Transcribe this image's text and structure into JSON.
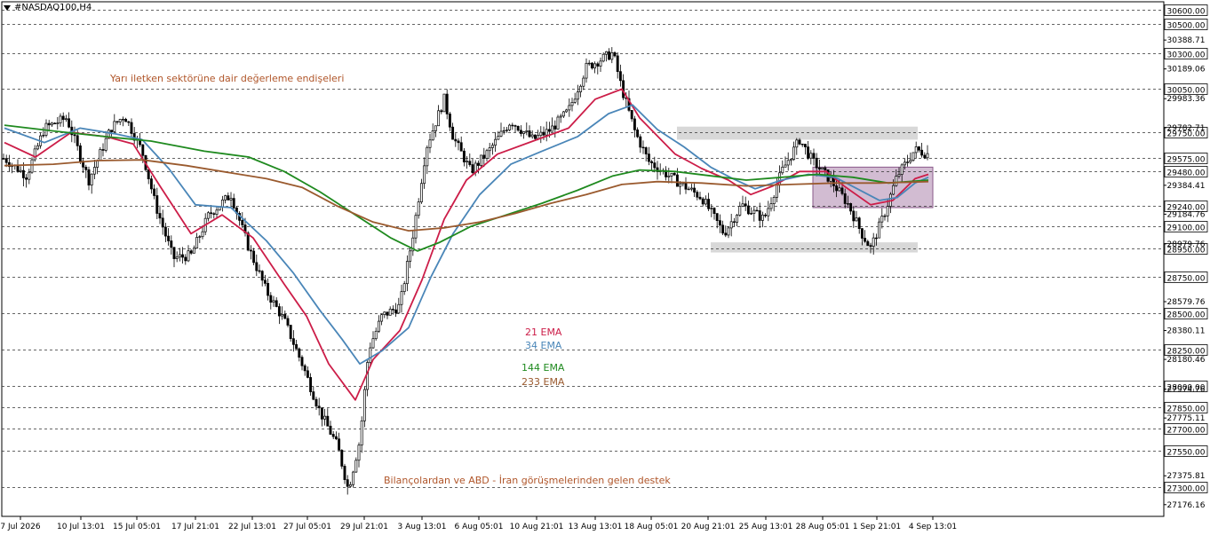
{
  "symbol_title": "#NASDAQ100,H4",
  "annotations": [
    {
      "text": "Yarı iletken sektörüne dair değerleme endişeleri",
      "color": "#b0562a"
    },
    {
      "text": "21 EMA",
      "color": "#cc1d48"
    },
    {
      "text": "34 EMA",
      "color": "#4a86b8"
    },
    {
      "text": "144 EMA",
      "color": "#1f8a1f"
    },
    {
      "text": "233 EMA",
      "color": "#9a5a2e"
    },
    {
      "text": "Bilançolardan ve ABD - İran görüşmelerinden gelen destek",
      "color": "#b0562a"
    }
  ],
  "colors": {
    "ema21": "#cc1d48",
    "ema34": "#4a86b8",
    "ema144": "#1f8a1f",
    "ema233": "#9a5a2e",
    "candles": "#000000",
    "zone_gray": "#c8c8c8",
    "zone_purple": "#9c6b9c"
  },
  "chart_data": {
    "type": "candlestick",
    "y_range": [
      27160,
      30660
    ],
    "x_range": [
      0,
      1310
    ],
    "level_labels": [
      "30600.00",
      "30500.00",
      "30300.00",
      "30050.00",
      "29750.00",
      "29575.00",
      "29480.00",
      "29240.00",
      "29100.00",
      "28950.00",
      "28750.00",
      "28500.00",
      "28250.00",
      "28000.00",
      "27850.00",
      "27700.00",
      "27550.00",
      "27300.00"
    ],
    "level_values": [
      30600,
      30500,
      30300,
      30050,
      29750,
      29575,
      29480,
      29240,
      29100,
      28950,
      28750,
      28500,
      28250,
      28000,
      27850,
      27700,
      27550,
      27300
    ],
    "axis_tick_labels": [
      "30388.71",
      "30189.06",
      "29983.36",
      "29782.71",
      "29384.41",
      "29184.76",
      "28979.76",
      "28579.76",
      "28380.11",
      "28180.46",
      "27974.76",
      "27775.11",
      "27375.81",
      "27176.16"
    ],
    "axis_tick_values": [
      30388.71,
      30189.06,
      29983.36,
      29782.71,
      29384.41,
      29184.76,
      28979.76,
      28579.76,
      28380.11,
      28180.46,
      27974.76,
      27775.11,
      27375.81,
      27176.16
    ],
    "x_tick_labels": [
      "7 Jul 2026",
      "10 Jul 13:01",
      "15 Jul 05:01",
      "17 Jul 21:01",
      "22 Jul 13:01",
      "27 Jul 05:01",
      "29 Jul 21:01",
      "3 Aug 13:01",
      "6 Aug 05:01",
      "10 Aug 21:01",
      "13 Aug 13:01",
      "18 Aug 05:01",
      "20 Aug 21:01",
      "25 Aug 13:01",
      "28 Aug 05:01",
      "1 Sep 21:01",
      "4 Sep 13:01"
    ],
    "x_tick_positions": [
      23,
      91,
      154,
      220,
      284,
      346,
      410,
      475,
      539,
      604,
      670,
      733,
      797,
      862,
      926,
      987,
      1050
    ],
    "price_path": [
      [
        5,
        29570
      ],
      [
        30,
        29450
      ],
      [
        50,
        29780
      ],
      [
        75,
        29850
      ],
      [
        100,
        29420
      ],
      [
        125,
        29780
      ],
      [
        140,
        29870
      ],
      [
        160,
        29620
      ],
      [
        175,
        29250
      ],
      [
        195,
        28880
      ],
      [
        215,
        28900
      ],
      [
        235,
        29180
      ],
      [
        260,
        29320
      ],
      [
        280,
        28950
      ],
      [
        300,
        28650
      ],
      [
        320,
        28450
      ],
      [
        340,
        28150
      ],
      [
        360,
        27820
      ],
      [
        380,
        27580
      ],
      [
        392,
        27280
      ],
      [
        405,
        27620
      ],
      [
        415,
        28250
      ],
      [
        430,
        28480
      ],
      [
        450,
        28550
      ],
      [
        465,
        29050
      ],
      [
        480,
        29650
      ],
      [
        500,
        29980
      ],
      [
        510,
        29720
      ],
      [
        530,
        29480
      ],
      [
        550,
        29620
      ],
      [
        575,
        29830
      ],
      [
        600,
        29700
      ],
      [
        620,
        29770
      ],
      [
        640,
        29900
      ],
      [
        660,
        30200
      ],
      [
        690,
        30300
      ],
      [
        700,
        30050
      ],
      [
        715,
        29750
      ],
      [
        730,
        29550
      ],
      [
        760,
        29420
      ],
      [
        790,
        29300
      ],
      [
        815,
        29050
      ],
      [
        835,
        29250
      ],
      [
        860,
        29150
      ],
      [
        880,
        29480
      ],
      [
        900,
        29700
      ],
      [
        915,
        29550
      ],
      [
        935,
        29420
      ],
      [
        955,
        29250
      ],
      [
        970,
        29050
      ],
      [
        980,
        28950
      ],
      [
        995,
        29180
      ],
      [
        1010,
        29450
      ],
      [
        1030,
        29630
      ],
      [
        1045,
        29600
      ]
    ],
    "series": [
      {
        "key": "ema21",
        "points": [
          [
            5,
            29680
          ],
          [
            40,
            29580
          ],
          [
            80,
            29750
          ],
          [
            120,
            29720
          ],
          [
            150,
            29670
          ],
          [
            180,
            29380
          ],
          [
            215,
            29050
          ],
          [
            250,
            29180
          ],
          [
            285,
            29020
          ],
          [
            320,
            28700
          ],
          [
            345,
            28480
          ],
          [
            370,
            28150
          ],
          [
            400,
            27900
          ],
          [
            420,
            28180
          ],
          [
            450,
            28380
          ],
          [
            475,
            28730
          ],
          [
            500,
            29150
          ],
          [
            525,
            29420
          ],
          [
            560,
            29600
          ],
          [
            600,
            29690
          ],
          [
            640,
            29780
          ],
          [
            670,
            29980
          ],
          [
            700,
            30050
          ],
          [
            720,
            29850
          ],
          [
            760,
            29600
          ],
          [
            790,
            29500
          ],
          [
            820,
            29420
          ],
          [
            845,
            29320
          ],
          [
            870,
            29380
          ],
          [
            900,
            29480
          ],
          [
            930,
            29480
          ],
          [
            950,
            29380
          ],
          [
            980,
            29250
          ],
          [
            1005,
            29280
          ],
          [
            1030,
            29430
          ],
          [
            1045,
            29460
          ]
        ]
      },
      {
        "key": "ema34",
        "points": [
          [
            5,
            29780
          ],
          [
            50,
            29680
          ],
          [
            90,
            29780
          ],
          [
            130,
            29740
          ],
          [
            160,
            29700
          ],
          [
            190,
            29500
          ],
          [
            220,
            29250
          ],
          [
            260,
            29230
          ],
          [
            300,
            29000
          ],
          [
            330,
            28780
          ],
          [
            360,
            28520
          ],
          [
            385,
            28320
          ],
          [
            405,
            28150
          ],
          [
            430,
            28240
          ],
          [
            460,
            28400
          ],
          [
            485,
            28750
          ],
          [
            510,
            29050
          ],
          [
            540,
            29320
          ],
          [
            575,
            29530
          ],
          [
            610,
            29620
          ],
          [
            650,
            29720
          ],
          [
            685,
            29880
          ],
          [
            712,
            29940
          ],
          [
            740,
            29770
          ],
          [
            770,
            29650
          ],
          [
            800,
            29510
          ],
          [
            825,
            29430
          ],
          [
            850,
            29360
          ],
          [
            880,
            29420
          ],
          [
            910,
            29460
          ],
          [
            940,
            29440
          ],
          [
            965,
            29360
          ],
          [
            990,
            29280
          ],
          [
            1010,
            29300
          ],
          [
            1030,
            29400
          ],
          [
            1045,
            29440
          ]
        ]
      },
      {
        "key": "ema144",
        "points": [
          [
            5,
            29800
          ],
          [
            60,
            29760
          ],
          [
            120,
            29720
          ],
          [
            170,
            29690
          ],
          [
            230,
            29620
          ],
          [
            280,
            29580
          ],
          [
            320,
            29480
          ],
          [
            360,
            29340
          ],
          [
            400,
            29180
          ],
          [
            440,
            29020
          ],
          [
            470,
            28930
          ],
          [
            495,
            28990
          ],
          [
            530,
            29100
          ],
          [
            570,
            29180
          ],
          [
            610,
            29260
          ],
          [
            650,
            29350
          ],
          [
            690,
            29450
          ],
          [
            720,
            29490
          ],
          [
            760,
            29480
          ],
          [
            800,
            29450
          ],
          [
            840,
            29420
          ],
          [
            880,
            29440
          ],
          [
            920,
            29460
          ],
          [
            960,
            29440
          ],
          [
            1000,
            29400
          ],
          [
            1045,
            29420
          ]
        ]
      },
      {
        "key": "ema233",
        "points": [
          [
            5,
            29520
          ],
          [
            60,
            29530
          ],
          [
            110,
            29555
          ],
          [
            160,
            29560
          ],
          [
            210,
            29520
          ],
          [
            260,
            29470
          ],
          [
            300,
            29430
          ],
          [
            340,
            29370
          ],
          [
            380,
            29240
          ],
          [
            420,
            29130
          ],
          [
            460,
            29070
          ],
          [
            500,
            29090
          ],
          [
            540,
            29130
          ],
          [
            580,
            29190
          ],
          [
            620,
            29260
          ],
          [
            660,
            29320
          ],
          [
            700,
            29390
          ],
          [
            740,
            29410
          ],
          [
            790,
            29400
          ],
          [
            840,
            29380
          ],
          [
            890,
            29390
          ],
          [
            940,
            29400
          ],
          [
            990,
            29400
          ],
          [
            1045,
            29410
          ]
        ]
      }
    ],
    "zones": [
      {
        "x0": 762,
        "x1": 1033,
        "y0": 29700,
        "y1": 29790,
        "type": "gray"
      },
      {
        "x0": 800,
        "x1": 1033,
        "y0": 28920,
        "y1": 28990,
        "type": "gray"
      },
      {
        "x0": 915,
        "x1": 1050,
        "y0": 29230,
        "y1": 29510,
        "type": "purple"
      }
    ]
  }
}
